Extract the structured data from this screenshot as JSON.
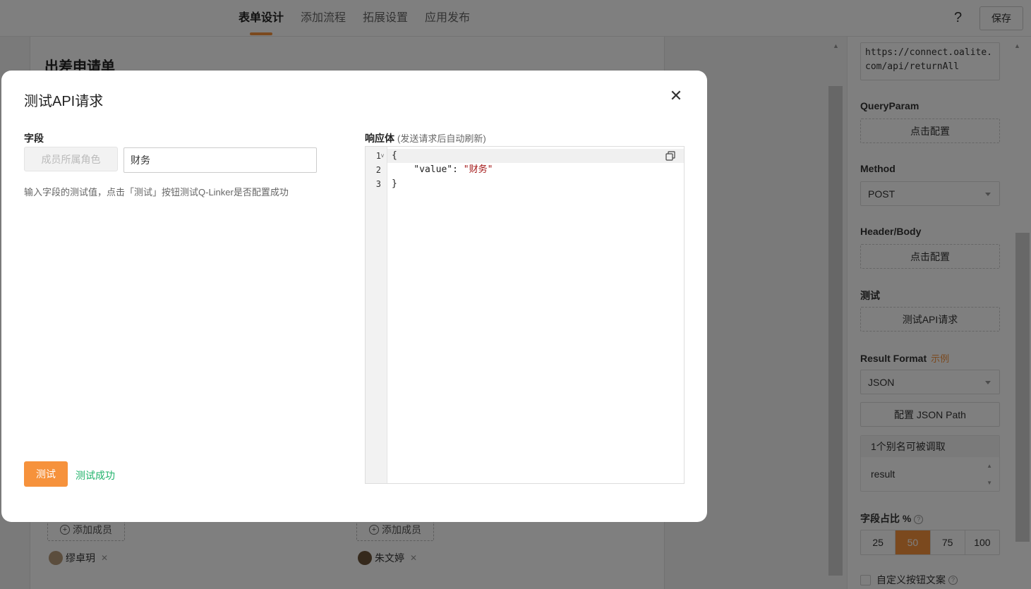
{
  "topbar": {
    "tabs": [
      {
        "label": "表单设计",
        "active": true
      },
      {
        "label": "添加流程",
        "active": false
      },
      {
        "label": "拓展设置",
        "active": false
      },
      {
        "label": "应用发布",
        "active": false
      }
    ],
    "help": "?",
    "save_label": "保存"
  },
  "form": {
    "title": "出差申请单",
    "add_member_label": "添加成员",
    "members": [
      "缪卓玥",
      "朱文婷"
    ]
  },
  "side": {
    "url": "https://connect.oalite.com/api/returnAll",
    "query_param_label": "QueryParam",
    "configure_label": "点击配置",
    "method_label": "Method",
    "method_value": "POST",
    "header_body_label": "Header/Body",
    "test_label": "测试",
    "test_api_button": "测试API请求",
    "result_format_label": "Result Format",
    "example_label": "示例",
    "result_format_value": "JSON",
    "config_json_path": "配置 JSON Path",
    "alias_header": "1个别名可被调取",
    "alias_item": "result",
    "ratio_label": "字段占比 %",
    "ratio_options": [
      "25",
      "50",
      "75",
      "100"
    ],
    "ratio_selected": "50",
    "custom_button_text_label": "自定义按钮文案"
  },
  "modal": {
    "title": "测试API请求",
    "field_label": "字段",
    "role_button": "成员所属角色",
    "input_value": "财务",
    "hint": "输入字段的测试值，点击「测试」按钮测试Q-Linker是否配置成功",
    "test_button": "测试",
    "test_status": "测试成功",
    "response_label": "响应体",
    "response_note": "(发送请求后自动刷新)",
    "response_lines": [
      {
        "num": "1",
        "text": "{"
      },
      {
        "num": "2",
        "key": "    \"value\": ",
        "value": "\"财务\""
      },
      {
        "num": "3",
        "text": "}"
      }
    ]
  },
  "colors": {
    "accent": "#f6923c",
    "success": "#1fb26a",
    "json_string": "#a31515"
  }
}
